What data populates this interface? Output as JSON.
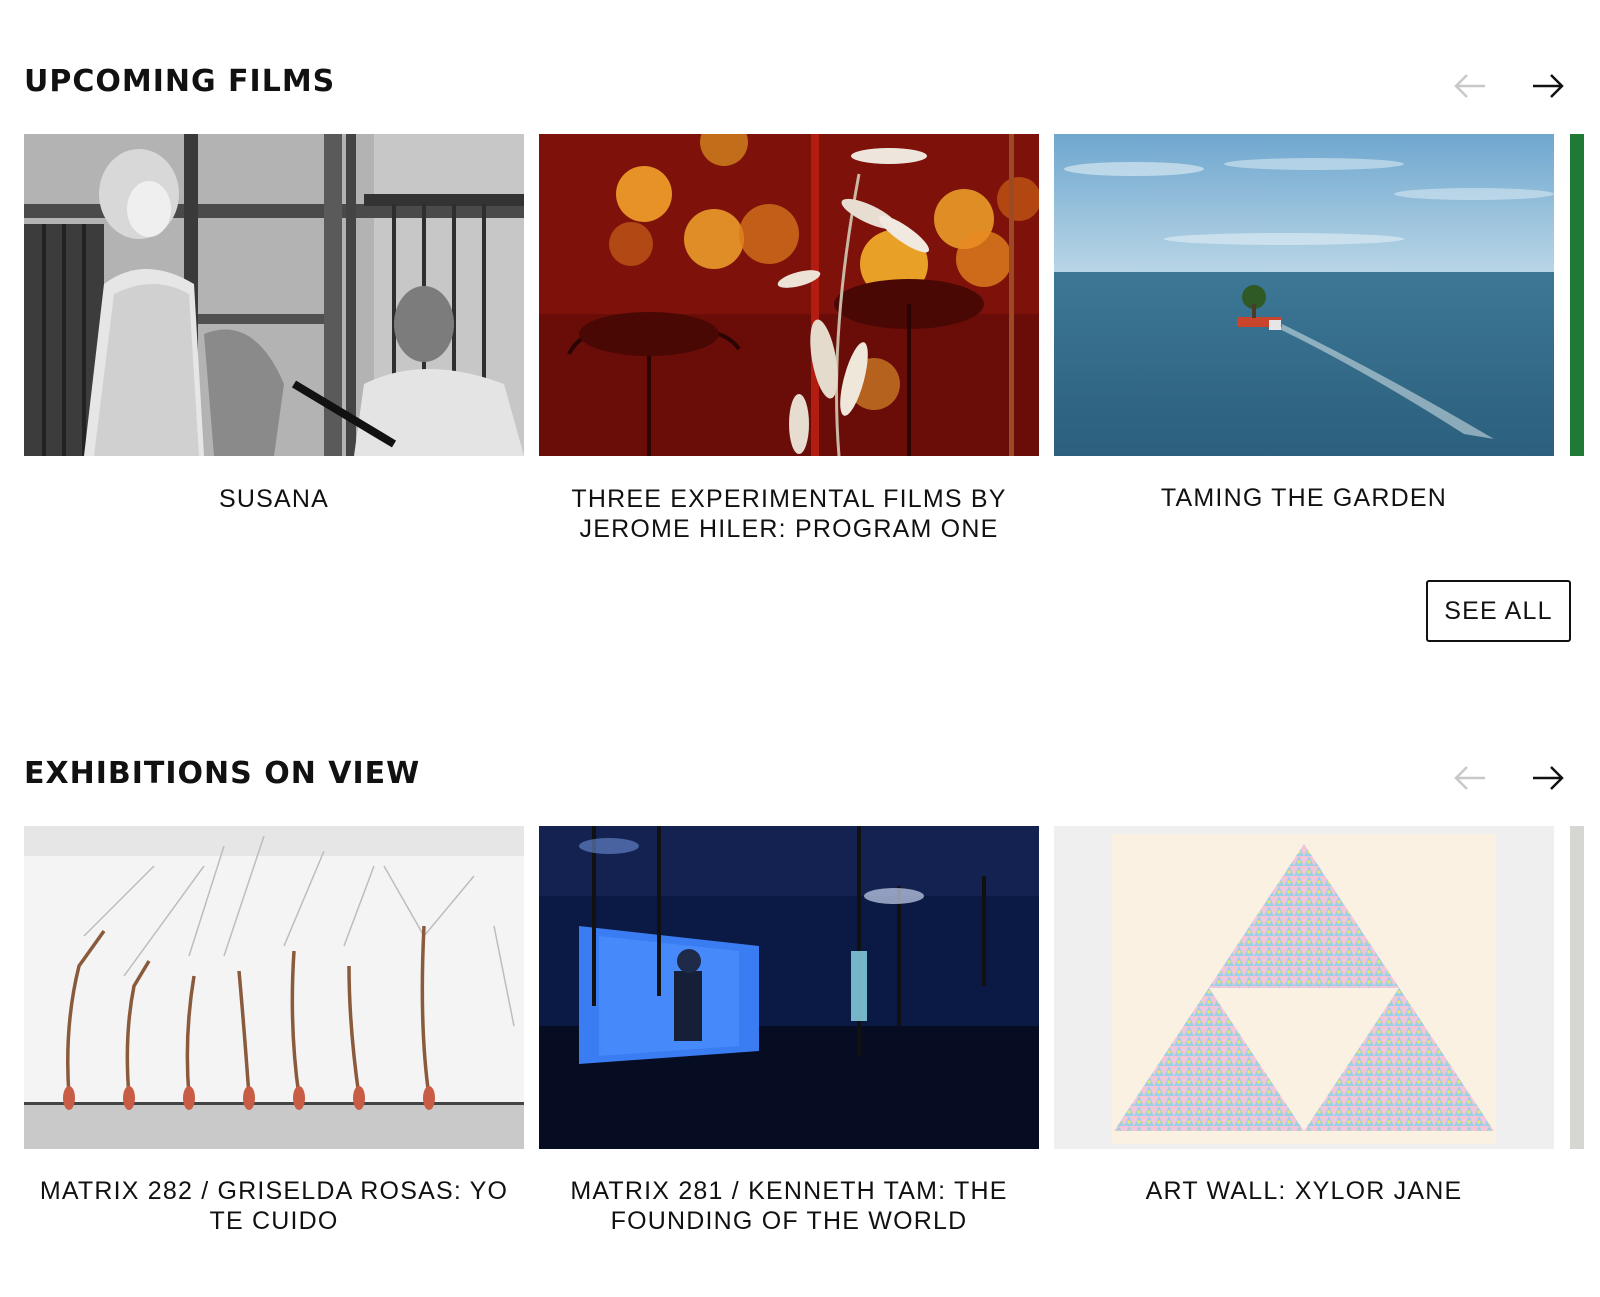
{
  "upcoming_films": {
    "title": "UPCOMING FILMS",
    "prev_icon": "arrow-left-icon",
    "next_icon": "arrow-right-icon",
    "cards": [
      {
        "title": "SUSANA"
      },
      {
        "title": "THREE EXPERIMENTAL FILMS BY JEROME HILER: PROGRAM ONE"
      },
      {
        "title": "TAMING THE GARDEN"
      }
    ],
    "see_all_label": "SEE ALL"
  },
  "exhibitions_on_view": {
    "title": "EXHIBITIONS ON VIEW",
    "prev_icon": "arrow-left-icon",
    "next_icon": "arrow-right-icon",
    "cards": [
      {
        "title": "MATRIX 282 / GRISELDA ROSAS: YO TE CUIDO"
      },
      {
        "title": "MATRIX 281 / KENNETH TAM: THE FOUNDING OF THE WORLD"
      },
      {
        "title": "ART WALL: XYLOR JANE"
      }
    ]
  },
  "colors": {
    "text": "#111111",
    "arrow_disabled": "#c8c8c8",
    "background": "#ffffff"
  }
}
